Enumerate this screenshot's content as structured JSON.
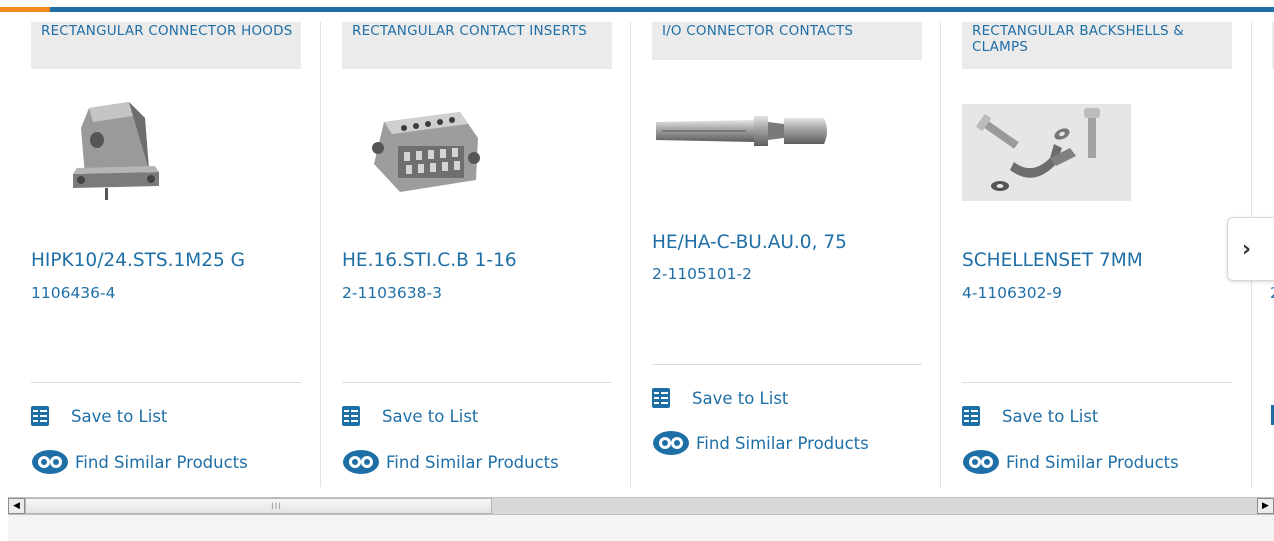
{
  "products": [
    {
      "category": "RECTANGULAR CONNECTOR HOODS",
      "name": "HIPK10/24.STS.1M25 G",
      "part_number": "1106436-4",
      "image": "connector-hood-image"
    },
    {
      "category": "RECTANGULAR CONTACT INSERTS",
      "name": "HE.16.STI.C.B 1-16",
      "part_number": "2-1103638-3",
      "image": "contact-insert-image"
    },
    {
      "category": "I/O CONNECTOR CONTACTS",
      "name": "HE/HA-C-BU.AU.0, 75",
      "part_number": "2-1105101-2",
      "image": "connector-contact-pin-image"
    },
    {
      "category": "RECTANGULAR BACKSHELLS & CLAMPS",
      "name": "SCHELLENSET 7MM",
      "part_number": "4-1106302-9",
      "image": "backshell-clamp-set-image"
    }
  ],
  "actions": {
    "save_label": "Save to List",
    "similar_label": "Find Similar Products"
  },
  "icons": {
    "save": "checklist-icon",
    "similar": "find-similar-icon",
    "next": "chevron-right-icon",
    "scroll_left": "scroll-left-arrow-icon",
    "scroll_right": "scroll-right-arrow-icon"
  },
  "carousel": {
    "next_glyph": "›",
    "scroll_left_glyph": "◀",
    "scroll_right_glyph": "▶",
    "partial_next_card_number_char": "2"
  },
  "colors": {
    "link_blue": "#1f6fa7",
    "accent_orange": "#f28a1d",
    "category_bg": "#ebebeb"
  }
}
